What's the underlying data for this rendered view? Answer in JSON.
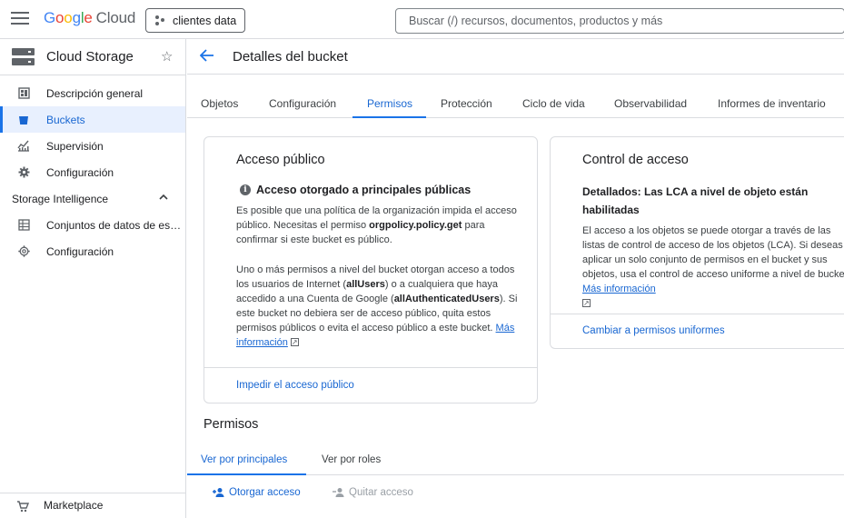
{
  "header": {
    "logo_letters": [
      "G",
      "o",
      "o",
      "g",
      "l",
      "e"
    ],
    "logo_suffix": "Cloud",
    "project": "clientes data",
    "search_placeholder": "Buscar (/) recursos, documentos, productos y más"
  },
  "sidebar": {
    "product": "Cloud Storage",
    "items": [
      {
        "label": "Descripción general",
        "icon": "dashboard-icon"
      },
      {
        "label": "Buckets",
        "icon": "bucket-icon"
      },
      {
        "label": "Supervisión",
        "icon": "chart-icon"
      },
      {
        "label": "Configuración",
        "icon": "gear-icon"
      }
    ],
    "section": "Storage Intelligence",
    "section_items": [
      {
        "label": "Conjuntos de datos de es…",
        "icon": "dataset-icon"
      },
      {
        "label": "Configuración",
        "icon": "settings-icon"
      }
    ],
    "marketplace": "Marketplace"
  },
  "page": {
    "title": "Detalles del bucket",
    "tabs": [
      "Objetos",
      "Configuración",
      "Permisos",
      "Protección",
      "Ciclo de vida",
      "Observabilidad",
      "Informes de inventario"
    ],
    "active_tab": "Permisos"
  },
  "public_card": {
    "title": "Acceso público",
    "status": "Acceso otorgado a principales públicas",
    "p1_a": "Es posible que una política de la organización impida el acceso público. Necesitas el permiso ",
    "p1_b": "orgpolicy.policy.get",
    "p1_c": " para confirmar si este bucket es público.",
    "p2_a": "Uno o más permisos a nivel del bucket otorgan acceso a todos los usuarios de Internet (",
    "p2_b": "allUsers",
    "p2_c": ") o a cualquiera que haya accedido a una Cuenta de Google (",
    "p2_d": "allAuthenticatedUsers",
    "p2_e": "). Si este bucket no debiera ser de acceso público, quita estos permisos públicos o evita el acceso público a este bucket. ",
    "more": "Más información",
    "action": "Impedir el acceso público"
  },
  "access_card": {
    "title": "Control de acceso",
    "subtitle": "Detallados: Las LCA a nivel de objeto están habilitadas",
    "text": "El acceso a los objetos se puede otorgar a través de las listas de control de acceso de los objetos (LCA). Si deseas aplicar un solo conjunto de permisos en el bucket y sus objetos, usa el control de acceso uniforme a nivel de bucket. ",
    "more": "Más información",
    "action": "Cambiar a permisos uniformes"
  },
  "permissions": {
    "title": "Permisos",
    "subtabs": [
      "Ver por principales",
      "Ver por roles"
    ],
    "grant": "Otorgar acceso",
    "remove": "Quitar acceso"
  },
  "colors": {
    "accent": "#1a73e8",
    "link": "#1967d2",
    "active_bg": "#e8f0fe",
    "border": "#dadce0"
  }
}
